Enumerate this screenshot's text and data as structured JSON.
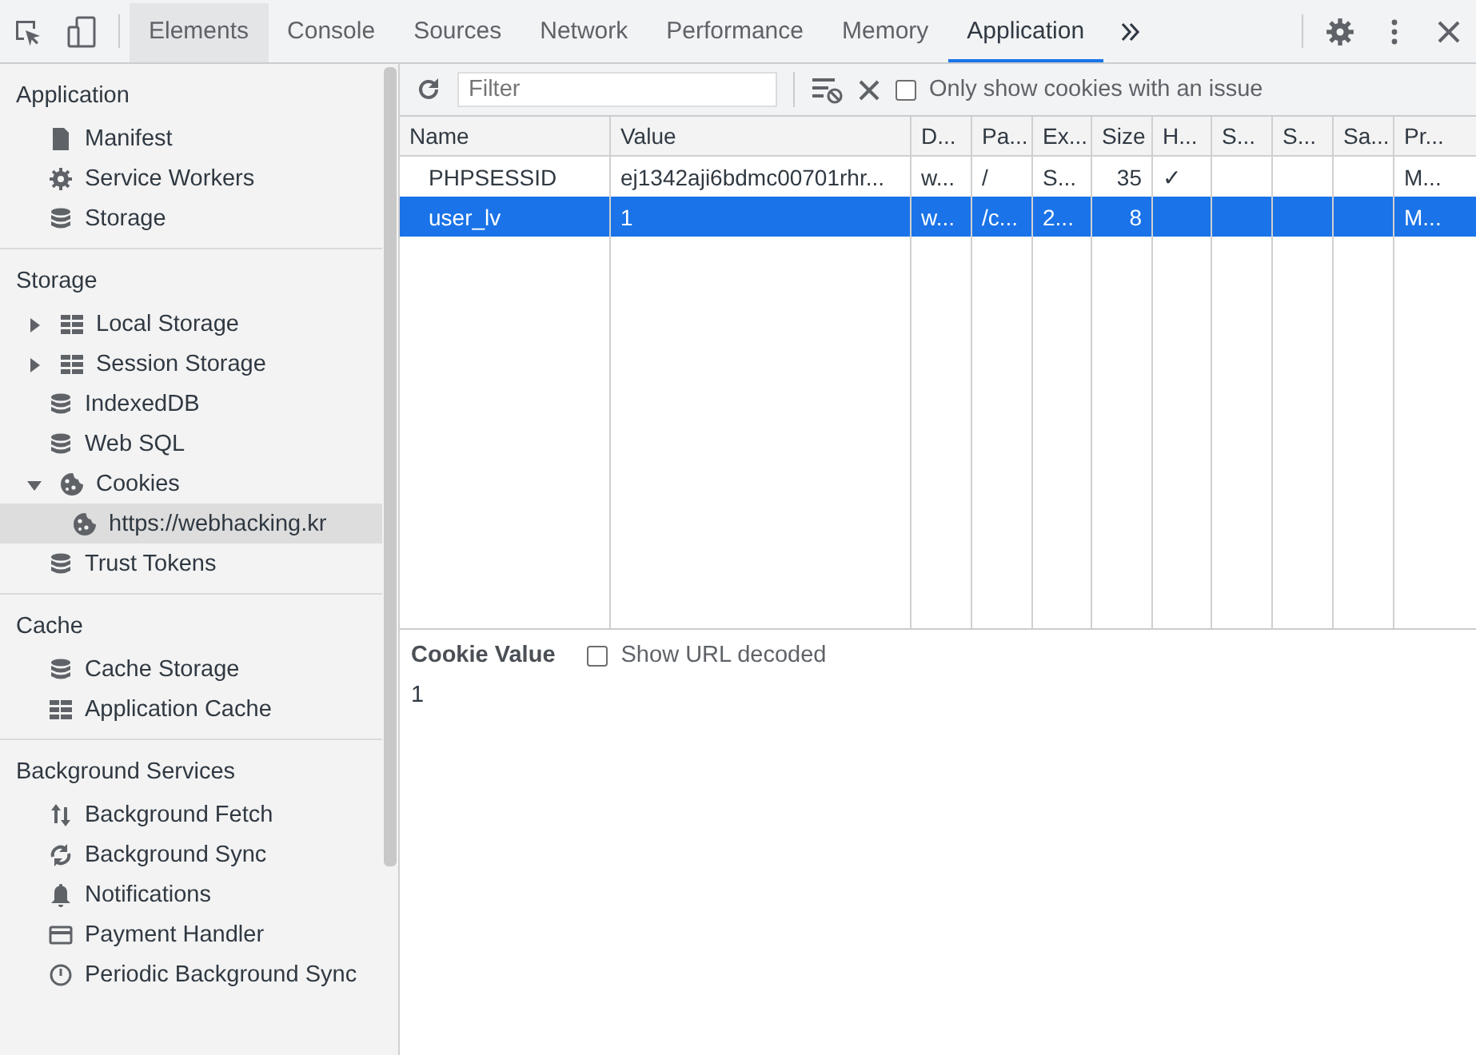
{
  "tabs": [
    {
      "label": "Elements",
      "selected": false,
      "hovered": true
    },
    {
      "label": "Console",
      "selected": false,
      "hovered": false
    },
    {
      "label": "Sources",
      "selected": false,
      "hovered": false
    },
    {
      "label": "Network",
      "selected": false,
      "hovered": false
    },
    {
      "label": "Performance",
      "selected": false,
      "hovered": false
    },
    {
      "label": "Memory",
      "selected": false,
      "hovered": false
    },
    {
      "label": "Application",
      "selected": true,
      "hovered": false
    }
  ],
  "sidebar": {
    "sections": [
      {
        "title": "Application",
        "items": [
          {
            "label": "Manifest",
            "kind": "file",
            "selected": false
          },
          {
            "label": "Service Workers",
            "kind": "gear",
            "selected": false
          },
          {
            "label": "Storage",
            "kind": "database",
            "selected": false
          }
        ]
      },
      {
        "title": "Storage",
        "items": [
          {
            "label": "Local Storage",
            "kind": "grid",
            "selected": false,
            "expanded": false
          },
          {
            "label": "Session Storage",
            "kind": "grid",
            "selected": false,
            "expanded": false
          },
          {
            "label": "IndexedDB",
            "kind": "database",
            "selected": false
          },
          {
            "label": "Web SQL",
            "kind": "database",
            "selected": false
          },
          {
            "label": "Cookies",
            "kind": "cookie",
            "selected": false,
            "expanded": true,
            "children": [
              {
                "label": "https://webhacking.kr",
                "kind": "cookie",
                "selected": true
              }
            ]
          },
          {
            "label": "Trust Tokens",
            "kind": "database",
            "selected": false
          }
        ]
      },
      {
        "title": "Cache",
        "items": [
          {
            "label": "Cache Storage",
            "kind": "database",
            "selected": false
          },
          {
            "label": "Application Cache",
            "kind": "grid",
            "selected": false
          }
        ]
      },
      {
        "title": "Background Services",
        "items": [
          {
            "label": "Background Fetch",
            "kind": "updown",
            "selected": false
          },
          {
            "label": "Background Sync",
            "kind": "sync",
            "selected": false
          },
          {
            "label": "Notifications",
            "kind": "bell",
            "selected": false
          },
          {
            "label": "Payment Handler",
            "kind": "card",
            "selected": false
          },
          {
            "label": "Periodic Background Sync",
            "kind": "clock",
            "selected": false
          }
        ]
      }
    ]
  },
  "toolbar": {
    "filter": {
      "placeholder": "Filter"
    },
    "issue_checkbox": {
      "label": "Only show cookies with an issue",
      "checked": false
    }
  },
  "table": {
    "columns": [
      "Name",
      "Value",
      "D...",
      "Pa...",
      "Ex...",
      "Size",
      "H...",
      "S...",
      "S...",
      "Sa...",
      "Pr..."
    ],
    "rows": [
      {
        "selected": false,
        "cells": [
          "PHPSESSID",
          "ej1342aji6bdmc00701rhr...",
          "w...",
          "/",
          "S...",
          "35",
          "✓",
          null,
          null,
          null,
          "M..."
        ]
      },
      {
        "selected": true,
        "cells": [
          "user_lv",
          "1",
          "w...",
          "/c...",
          "2...",
          "8",
          null,
          null,
          null,
          null,
          "M..."
        ]
      }
    ]
  },
  "cookie_value": {
    "title": "Cookie Value",
    "decode_checkbox": {
      "label": "Show URL decoded",
      "checked": false
    },
    "value": "1"
  }
}
